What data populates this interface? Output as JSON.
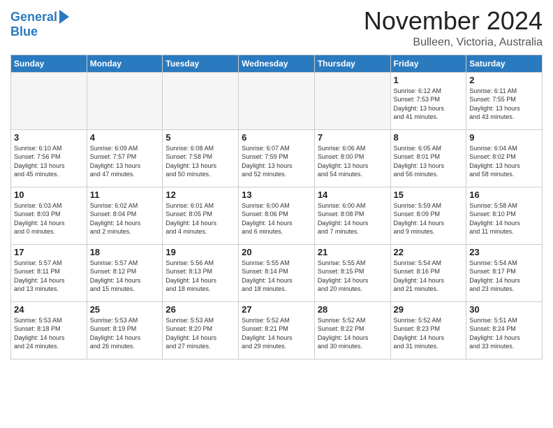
{
  "header": {
    "logo_line1": "General",
    "logo_line2": "Blue",
    "month": "November 2024",
    "location": "Bulleen, Victoria, Australia"
  },
  "weekdays": [
    "Sunday",
    "Monday",
    "Tuesday",
    "Wednesday",
    "Thursday",
    "Friday",
    "Saturday"
  ],
  "weeks": [
    [
      {
        "day": "",
        "info": ""
      },
      {
        "day": "",
        "info": ""
      },
      {
        "day": "",
        "info": ""
      },
      {
        "day": "",
        "info": ""
      },
      {
        "day": "",
        "info": ""
      },
      {
        "day": "1",
        "info": "Sunrise: 6:12 AM\nSunset: 7:53 PM\nDaylight: 13 hours\nand 41 minutes."
      },
      {
        "day": "2",
        "info": "Sunrise: 6:11 AM\nSunset: 7:55 PM\nDaylight: 13 hours\nand 43 minutes."
      }
    ],
    [
      {
        "day": "3",
        "info": "Sunrise: 6:10 AM\nSunset: 7:56 PM\nDaylight: 13 hours\nand 45 minutes."
      },
      {
        "day": "4",
        "info": "Sunrise: 6:09 AM\nSunset: 7:57 PM\nDaylight: 13 hours\nand 47 minutes."
      },
      {
        "day": "5",
        "info": "Sunrise: 6:08 AM\nSunset: 7:58 PM\nDaylight: 13 hours\nand 50 minutes."
      },
      {
        "day": "6",
        "info": "Sunrise: 6:07 AM\nSunset: 7:59 PM\nDaylight: 13 hours\nand 52 minutes."
      },
      {
        "day": "7",
        "info": "Sunrise: 6:06 AM\nSunset: 8:00 PM\nDaylight: 13 hours\nand 54 minutes."
      },
      {
        "day": "8",
        "info": "Sunrise: 6:05 AM\nSunset: 8:01 PM\nDaylight: 13 hours\nand 56 minutes."
      },
      {
        "day": "9",
        "info": "Sunrise: 6:04 AM\nSunset: 8:02 PM\nDaylight: 13 hours\nand 58 minutes."
      }
    ],
    [
      {
        "day": "10",
        "info": "Sunrise: 6:03 AM\nSunset: 8:03 PM\nDaylight: 14 hours\nand 0 minutes."
      },
      {
        "day": "11",
        "info": "Sunrise: 6:02 AM\nSunset: 8:04 PM\nDaylight: 14 hours\nand 2 minutes."
      },
      {
        "day": "12",
        "info": "Sunrise: 6:01 AM\nSunset: 8:05 PM\nDaylight: 14 hours\nand 4 minutes."
      },
      {
        "day": "13",
        "info": "Sunrise: 6:00 AM\nSunset: 8:06 PM\nDaylight: 14 hours\nand 6 minutes."
      },
      {
        "day": "14",
        "info": "Sunrise: 6:00 AM\nSunset: 8:08 PM\nDaylight: 14 hours\nand 7 minutes."
      },
      {
        "day": "15",
        "info": "Sunrise: 5:59 AM\nSunset: 8:09 PM\nDaylight: 14 hours\nand 9 minutes."
      },
      {
        "day": "16",
        "info": "Sunrise: 5:58 AM\nSunset: 8:10 PM\nDaylight: 14 hours\nand 11 minutes."
      }
    ],
    [
      {
        "day": "17",
        "info": "Sunrise: 5:57 AM\nSunset: 8:11 PM\nDaylight: 14 hours\nand 13 minutes."
      },
      {
        "day": "18",
        "info": "Sunrise: 5:57 AM\nSunset: 8:12 PM\nDaylight: 14 hours\nand 15 minutes."
      },
      {
        "day": "19",
        "info": "Sunrise: 5:56 AM\nSunset: 8:13 PM\nDaylight: 14 hours\nand 18 minutes."
      },
      {
        "day": "20",
        "info": "Sunrise: 5:55 AM\nSunset: 8:14 PM\nDaylight: 14 hours\nand 18 minutes."
      },
      {
        "day": "21",
        "info": "Sunrise: 5:55 AM\nSunset: 8:15 PM\nDaylight: 14 hours\nand 20 minutes."
      },
      {
        "day": "22",
        "info": "Sunrise: 5:54 AM\nSunset: 8:16 PM\nDaylight: 14 hours\nand 21 minutes."
      },
      {
        "day": "23",
        "info": "Sunrise: 5:54 AM\nSunset: 8:17 PM\nDaylight: 14 hours\nand 23 minutes."
      }
    ],
    [
      {
        "day": "24",
        "info": "Sunrise: 5:53 AM\nSunset: 8:18 PM\nDaylight: 14 hours\nand 24 minutes."
      },
      {
        "day": "25",
        "info": "Sunrise: 5:53 AM\nSunset: 8:19 PM\nDaylight: 14 hours\nand 26 minutes."
      },
      {
        "day": "26",
        "info": "Sunrise: 5:53 AM\nSunset: 8:20 PM\nDaylight: 14 hours\nand 27 minutes."
      },
      {
        "day": "27",
        "info": "Sunrise: 5:52 AM\nSunset: 8:21 PM\nDaylight: 14 hours\nand 29 minutes."
      },
      {
        "day": "28",
        "info": "Sunrise: 5:52 AM\nSunset: 8:22 PM\nDaylight: 14 hours\nand 30 minutes."
      },
      {
        "day": "29",
        "info": "Sunrise: 5:52 AM\nSunset: 8:23 PM\nDaylight: 14 hours\nand 31 minutes."
      },
      {
        "day": "30",
        "info": "Sunrise: 5:51 AM\nSunset: 8:24 PM\nDaylight: 14 hours\nand 33 minutes."
      }
    ]
  ]
}
